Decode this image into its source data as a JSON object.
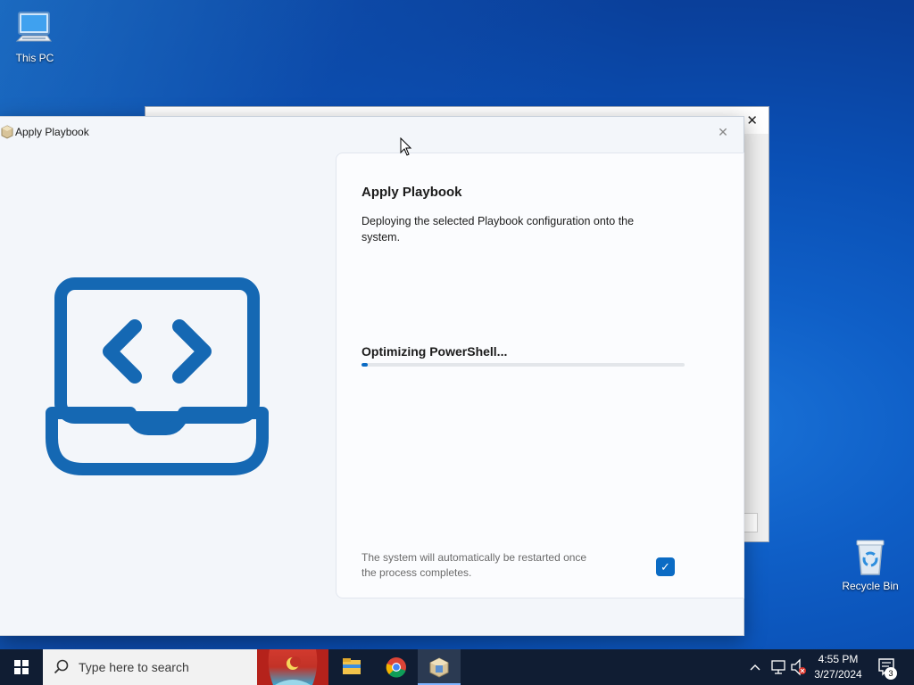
{
  "desktop": {
    "icons": [
      {
        "label": "This PC",
        "icon": "computer-icon"
      },
      {
        "label": "Recycle Bin",
        "icon": "recycle-bin-icon"
      }
    ]
  },
  "window": {
    "title": "Apply Playbook",
    "close_glyph": "✕"
  },
  "card": {
    "heading": "Apply Playbook",
    "description": "Deploying the selected Playbook configuration onto the system.",
    "status": "Optimizing PowerShell...",
    "progress": 0.02,
    "restart_note": "The system will automatically be restarted once the process completes.",
    "restart_checked": true
  },
  "background_window": {
    "close_glyph": "✕"
  },
  "taskbar": {
    "search_placeholder": "Type here to search",
    "pinned": [
      "file-explorer-icon",
      "chrome-icon",
      "playbook-app-icon"
    ],
    "clock_time": "4:55 PM",
    "clock_date": "3/27/2024",
    "notification_count": "3"
  },
  "colors": {
    "accent": "#0b6bc4",
    "taskbar": "#101d33",
    "hero_blue": "#1568b3"
  }
}
